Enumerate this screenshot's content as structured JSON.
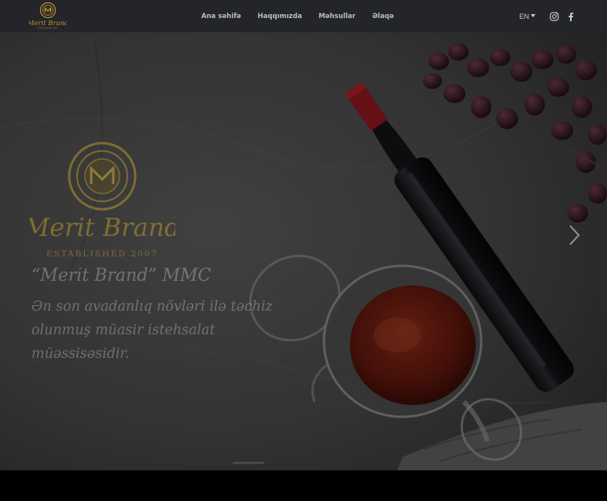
{
  "brand": {
    "name": "Merit Brand",
    "established": "ESTABLISHED 2007",
    "logo_icon": "merit-brand-crest",
    "gold": "#b8962e"
  },
  "nav": {
    "items": [
      {
        "label": "Ana səhifə"
      },
      {
        "label": "Haqqımızda"
      },
      {
        "label": "Məhsullar"
      },
      {
        "label": "Əlaqə"
      }
    ],
    "language": "EN",
    "social_icons": [
      "instagram-icon",
      "facebook-icon"
    ],
    "background": "#23252a"
  },
  "hero": {
    "title": "“Merit Brand” MMC",
    "subtitle": "Ən son avadanlıq növləri ilə təchiz olunmuş müasir istehsalat müəssisəsidir.",
    "next_icon": "chevron-right-icon",
    "wine_color": "#6e1c12",
    "capsule_color": "#8d1520"
  }
}
